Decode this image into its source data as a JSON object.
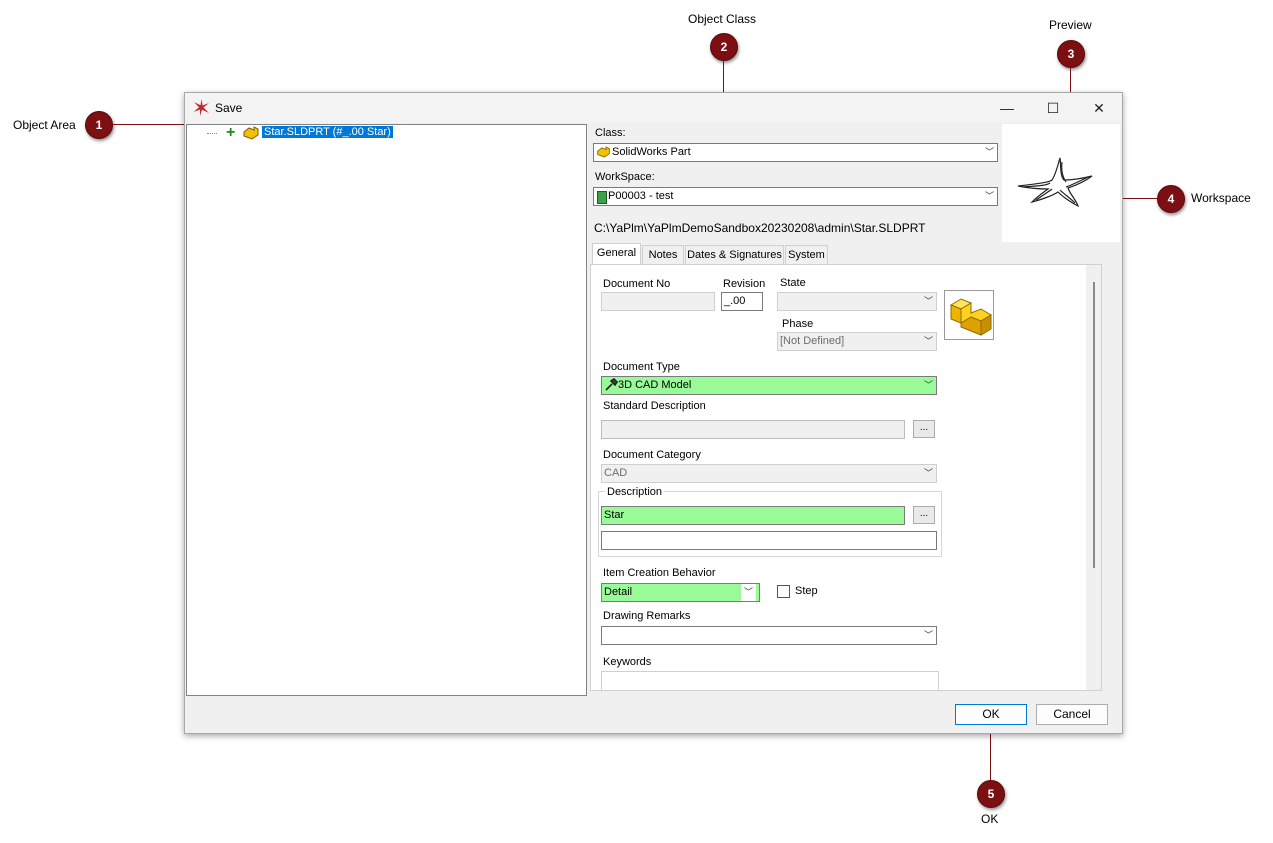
{
  "callouts": {
    "object_area": {
      "number": "1",
      "label": "Object Area"
    },
    "object_class": {
      "number": "2",
      "label": "Object Class"
    },
    "preview": {
      "number": "3",
      "label": "Preview"
    },
    "workspace": {
      "number": "4",
      "label": "Workspace"
    },
    "ok": {
      "number": "5",
      "label": "OK"
    }
  },
  "window": {
    "title": "Save",
    "minimize": "—",
    "maximize": "☐",
    "close": "✕"
  },
  "tree": {
    "item_label": "Star.SLDPRT (#_.00 Star)"
  },
  "class": {
    "label": "Class:",
    "value": "SolidWorks Part"
  },
  "workspace": {
    "label": "WorkSpace:",
    "value": "P00003 - test"
  },
  "path": "C:\\YaPlm\\YaPlmDemoSandbox20230208\\admin\\Star.SLDPRT",
  "tabs": [
    {
      "label": "General"
    },
    {
      "label": "Notes"
    },
    {
      "label": "Dates & Signatures"
    },
    {
      "label": "System"
    }
  ],
  "general": {
    "document_no_label": "Document No",
    "document_no_value": "",
    "revision_label": "Revision",
    "revision_value": "_.00",
    "state_label": "State",
    "state_value": "",
    "phase_label": "Phase",
    "phase_value": "[Not Defined]",
    "document_type_label": "Document Type",
    "document_type_value": "3D CAD Model",
    "standard_description_label": "Standard Description",
    "standard_description_value": "",
    "document_category_label": "Document Category",
    "document_category_value": "CAD",
    "description_group_label": "Description",
    "description_value": "Star",
    "description_value2": "",
    "item_creation_label": "Item Creation Behavior",
    "item_creation_value": "Detail",
    "step_label": "Step",
    "drawing_remarks_label": "Drawing Remarks",
    "drawing_remarks_value": "",
    "keywords_label": "Keywords",
    "ellipsis": "..."
  },
  "buttons": {
    "ok": "OK",
    "cancel": "Cancel"
  },
  "colors": {
    "callout": "#7b0f12",
    "required_field": "#98fb98",
    "selection": "#0078d7"
  }
}
